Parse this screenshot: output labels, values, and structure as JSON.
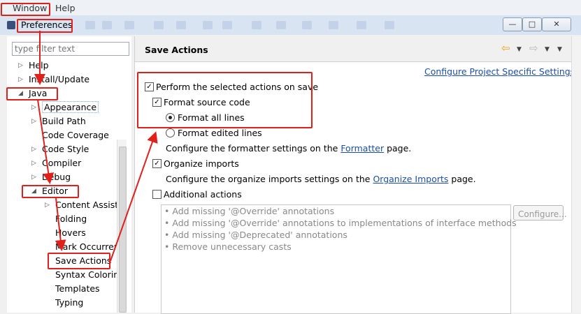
{
  "menubar": {
    "window": "Window",
    "help": "Help"
  },
  "dialog": {
    "title": "Preferences"
  },
  "filter": {
    "placeholder": "type filter text"
  },
  "tree": {
    "help": "Help",
    "install_update": "Install/Update",
    "java": "Java",
    "appearance": "Appearance",
    "build_path": "Build Path",
    "code_coverage": "Code Coverage",
    "code_style": "Code Style",
    "compiler": "Compiler",
    "debug": "Debug",
    "editor": "Editor",
    "content_assist": "Content Assist",
    "folding": "Folding",
    "hovers": "Hovers",
    "mark_occurrences": "Mark Occurren",
    "save_actions": "Save Actions",
    "syntax_coloring": "Syntax Coloring",
    "templates": "Templates",
    "typing": "Typing"
  },
  "page": {
    "title": "Save Actions",
    "configure_link": "Configure Project Specific Settings...",
    "perform_label": "Perform the selected actions on save",
    "format_source": "Format source code",
    "format_all": "Format all lines",
    "format_edited": "Format edited lines",
    "formatter_prefix": "Configure the formatter settings on the ",
    "formatter_link": "Formatter",
    "formatter_suffix": " page.",
    "organize_imports": "Organize imports",
    "organize_prefix": "Configure the organize imports settings on the ",
    "organize_link": "Organize Imports",
    "organize_suffix": " page.",
    "additional": "Additional actions",
    "additional_items": [
      "Add missing '@Override' annotations",
      "Add missing '@Override' annotations to implementations of interface methods",
      "Add missing '@Deprecated' annotations",
      "Remove unnecessary casts"
    ],
    "configure_button": "Configure..."
  },
  "state": {
    "perform_checked": true,
    "format_source_checked": true,
    "format_all_selected": true,
    "organize_checked": true,
    "additional_checked": false
  },
  "icons": {
    "tree_expanded": "triangle-down-icon",
    "tree_collapsed": "triangle-right-icon",
    "nav_back": "back-arrow-icon",
    "nav_forward": "forward-arrow-icon",
    "view_menu": "view-menu-icon",
    "checkmark": "checkmark-icon"
  },
  "colors": {
    "annotation_red": "#e0201b",
    "link_blue": "#1a4fa8",
    "nav_back_orange": "#f0a020"
  }
}
